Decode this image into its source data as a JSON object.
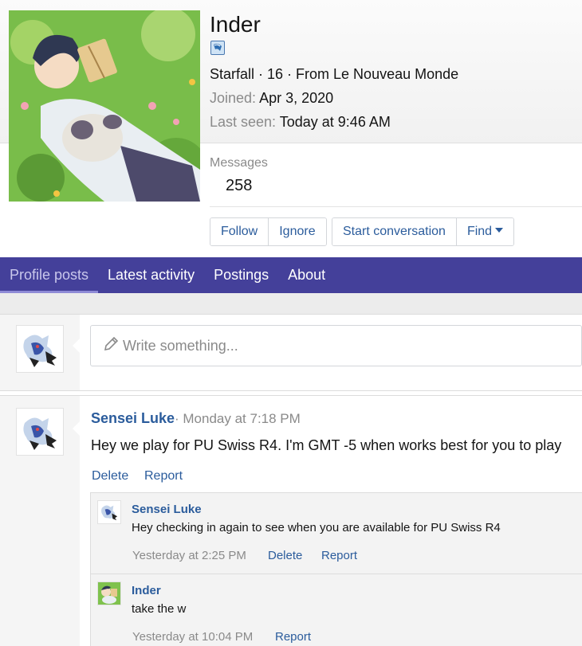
{
  "profile": {
    "name": "Inder",
    "blurb": "Starfall · 16 · From Le Nouveau Monde",
    "joined_label": "Joined:",
    "joined_value": "Apr 3, 2020",
    "last_seen_label": "Last seen:",
    "last_seen_value": "Today at 9:46 AM",
    "stats": {
      "messages_label": "Messages",
      "messages_value": "258"
    },
    "actions": {
      "follow": "Follow",
      "ignore": "Ignore",
      "start_conversation": "Start conversation",
      "find": "Find"
    }
  },
  "tabs": [
    {
      "label": "Profile posts",
      "active": true
    },
    {
      "label": "Latest activity",
      "active": false
    },
    {
      "label": "Postings",
      "active": false
    },
    {
      "label": "About",
      "active": false
    }
  ],
  "composer": {
    "placeholder": "Write something..."
  },
  "post": {
    "author": "Sensei Luke",
    "time": "· Monday at 7:18 PM",
    "body": "Hey we play for PU Swiss R4. I'm GMT -5 when works best for you to play",
    "delete_label": "Delete",
    "report_label": "Report"
  },
  "comments": [
    {
      "author": "Sensei Luke",
      "body": "Hey checking in again to see when you are available for PU Swiss R4",
      "time": "Yesterday at 2:25 PM",
      "delete_label": "Delete",
      "report_label": "Report"
    },
    {
      "author": "Inder",
      "body": "take the w",
      "time": "Yesterday at 10:04 PM",
      "report_label": "Report"
    }
  ],
  "colors": {
    "accent": "#44409a",
    "link": "#2b5c9c",
    "muted": "#8a8a8a"
  },
  "icons": {
    "rank": "rank-badge-icon",
    "pencil": "pencil-icon",
    "find_caret": "caret-down-icon"
  }
}
